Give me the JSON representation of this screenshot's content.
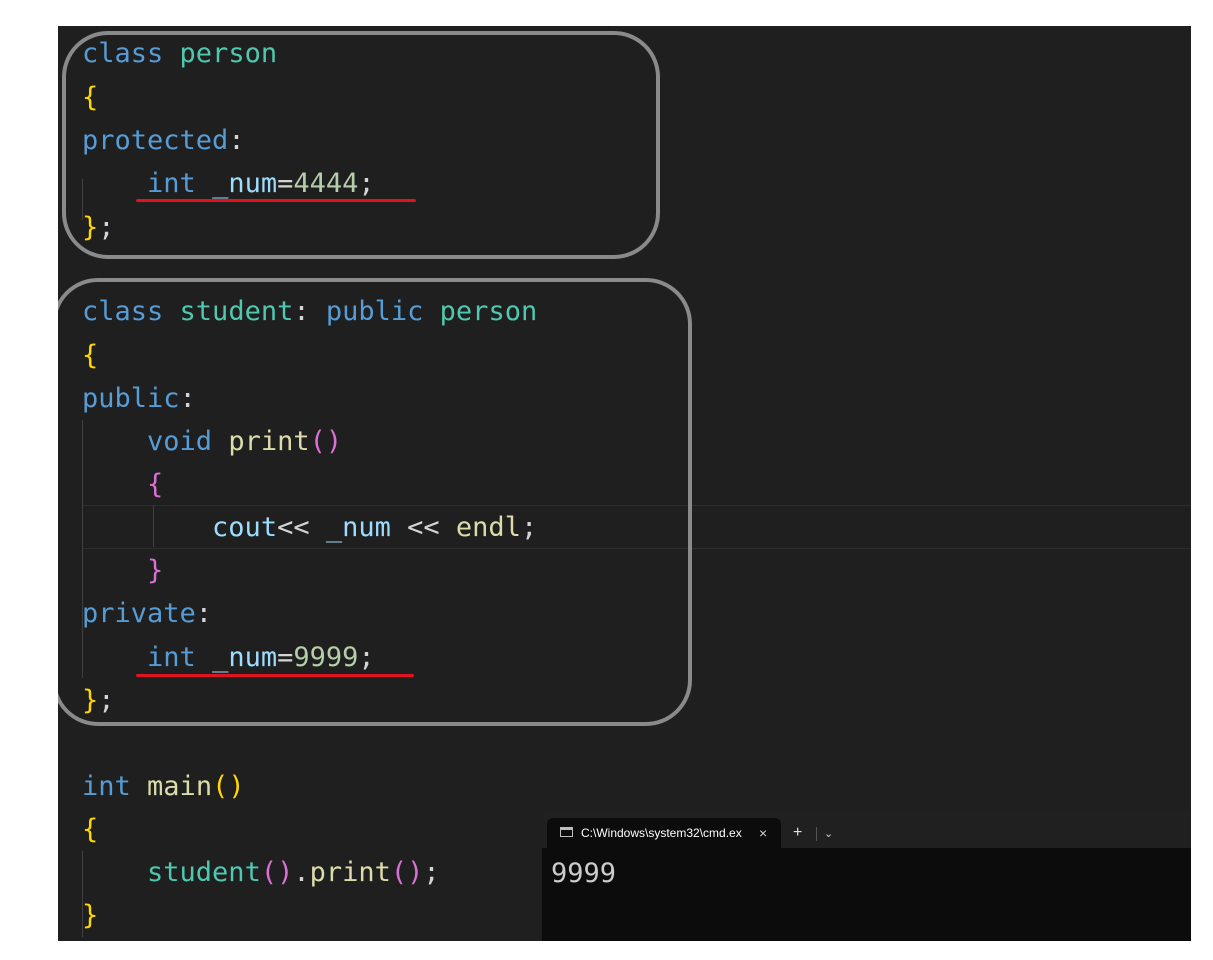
{
  "editor": {
    "lines": {
      "l1": {
        "t1": "class",
        "t2": " ",
        "t3": "person"
      },
      "l2": {
        "t1": "{"
      },
      "l3": {
        "t1": "protected",
        "t2": ":"
      },
      "l4": {
        "t1": "    ",
        "t2": "int",
        "t3": " ",
        "t4": "_num",
        "t5": "=",
        "t6": "4444",
        "t7": ";"
      },
      "l5": {
        "t1": "}",
        "t2": ";"
      },
      "l6": {
        "t1": "class",
        "t2": " ",
        "t3": "student",
        "t4": ": ",
        "t5": "public",
        "t6": " ",
        "t7": "person"
      },
      "l7": {
        "t1": "{"
      },
      "l8": {
        "t1": "public",
        "t2": ":"
      },
      "l9": {
        "t1": "    ",
        "t2": "void",
        "t3": " ",
        "t4": "print",
        "t5": "()"
      },
      "l10": {
        "t1": "    ",
        "t2": "{"
      },
      "l11": {
        "t1": "        ",
        "t2": "cout",
        "t3": "<< ",
        "t4": "_num",
        "t5": " << ",
        "t6": "endl",
        "t7": ";"
      },
      "l12": {
        "t1": "    ",
        "t2": "}"
      },
      "l13": {
        "t1": "private",
        "t2": ":"
      },
      "l14": {
        "t1": "    ",
        "t2": "int",
        "t3": " ",
        "t4": "_num",
        "t5": "=",
        "t6": "9999",
        "t7": ";"
      },
      "l15": {
        "t1": "}",
        "t2": ";"
      },
      "l16": {
        "t1": "int",
        "t2": " ",
        "t3": "main",
        "t4": "()"
      },
      "l17": {
        "t1": "{"
      },
      "l18": {
        "t1": "    ",
        "t2": "student",
        "t3": "()",
        "t4": ".",
        "t5": "print",
        "t6": "()",
        "t7": ";"
      },
      "l19": {
        "t1": "}"
      }
    }
  },
  "terminal": {
    "tab_icon": "console-icon",
    "tab_title": "C:\\Windows\\system32\\cmd.ex",
    "tab_close": "×",
    "new_tab": "+",
    "dropdown": "⌄",
    "output": "9999"
  },
  "colors": {
    "editor_bg": "#1f1f1f",
    "keyword": "#569cd6",
    "type_name": "#4ec9b0",
    "function": "#dcdcaa",
    "variable": "#9cdcfe",
    "number": "#b5cea8",
    "bracket_level1": "#ffd700",
    "bracket_level2": "#da70d6",
    "annotation_box": "#8a8a8a",
    "annotation_underline": "#e0141e",
    "terminal_bg": "#0c0c0c"
  }
}
